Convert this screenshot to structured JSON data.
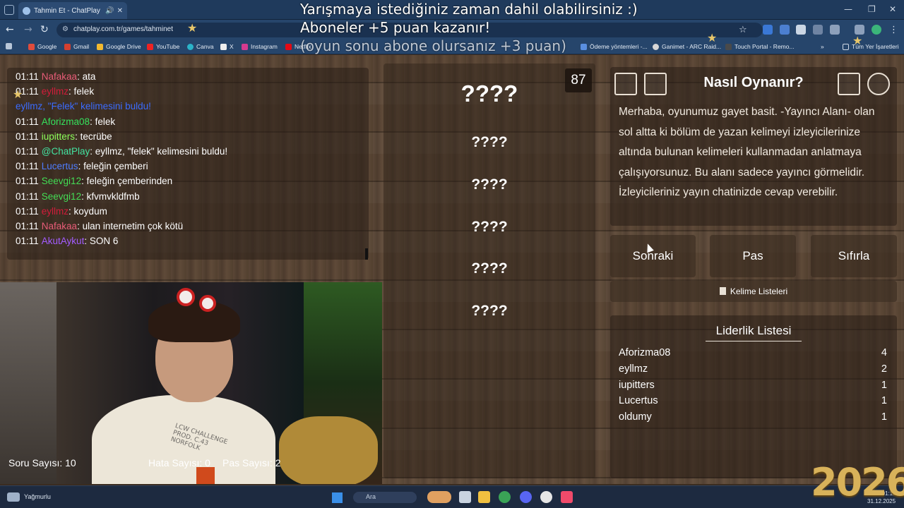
{
  "browser": {
    "tab_title": "Tahmin Et - ChatPlay",
    "url": "chatplay.com.tr/games/tahminet",
    "bookmarks": [
      "Google",
      "Gmail",
      "Google Drive",
      "YouTube",
      "Canva",
      "X",
      "Instagram",
      "Netflix",
      "Ödeme yöntemleri -...",
      "Ganimet - ARC Raid...",
      "Touch Portal - Remo..."
    ],
    "all_bookmarks": "Tüm Yer İşaretleri"
  },
  "overlay": {
    "line1": "Yarışmaya istediğiniz zaman dahil olabilirsiniz :)",
    "line2": "Aboneler +5 puan kazanır!",
    "line3": "(oyun sonu abone olursanız +3 puan)"
  },
  "chat": [
    {
      "time": "01:11",
      "user": "Nafakaa",
      "color": "#e85c78",
      "msg": ": ata"
    },
    {
      "time": "01:11",
      "user": "eyllmz",
      "color": "#d11c3a",
      "msg": ": felek"
    },
    {
      "time": "",
      "user": "",
      "color": "#3b6cff",
      "msg": "eyllmz, \"Felek\" kelimesini buldu!",
      "system": true
    },
    {
      "time": "01:11",
      "user": "Aforizma08",
      "color": "#35e25c",
      "msg": ": felek"
    },
    {
      "time": "01:11",
      "user": "iupitters",
      "color": "#8cff5a",
      "msg": ": tecrübe"
    },
    {
      "time": "01:11",
      "user": "@ChatPlay",
      "color": "#43e2a0",
      "msg": ": eyllmz, \"felek\" kelimesini buldu!"
    },
    {
      "time": "01:11",
      "user": "Lucertus",
      "color": "#4f7dff",
      "msg": ": feleğin çemberi"
    },
    {
      "time": "01:11",
      "user": "Seevgi12",
      "color": "#44dd55",
      "msg": ": feleğin çemberinden"
    },
    {
      "time": "01:11",
      "user": "Seevgi12",
      "color": "#44dd55",
      "msg": ": kfvmvkldfmb"
    },
    {
      "time": "01:11",
      "user": "eyllmz",
      "color": "#d11c3a",
      "msg": ": koydum"
    },
    {
      "time": "01:11",
      "user": "Nafakaa",
      "color": "#e85c78",
      "msg": ": ulan internetim çok kötü"
    },
    {
      "time": "01:11",
      "user": "AkutAykut",
      "color": "#a35cff",
      "msg": ": SON 6"
    }
  ],
  "game": {
    "counter": "87",
    "words": [
      "????",
      "????",
      "????",
      "????",
      "????",
      "????"
    ]
  },
  "howto": {
    "title": "Nasıl Oynanır?",
    "text": "Merhaba, oyunumuz gayet basit. -Yayıncı Alanı- olan sol altta ki bölüm de yazan kelimeyi izleyicilerinize altında bulunan kelimeleri kullanmadan anlatmaya çalışıyorsunuz. Bu alanı sadece yayıncı görmelidir. İzleyicileriniz yayın chatinizde cevap verebilir."
  },
  "buttons": {
    "next": "Sonraki",
    "pass": "Pas",
    "reset": "Sıfırla",
    "wordlists": "Kelime Listeleri"
  },
  "leaderboard": {
    "title": "Liderlik Listesi",
    "rows": [
      {
        "name": "Aforizma08",
        "score": "4"
      },
      {
        "name": "eyllmz",
        "score": "2"
      },
      {
        "name": "iupitters",
        "score": "1"
      },
      {
        "name": "Lucertus",
        "score": "1"
      },
      {
        "name": "oldumy",
        "score": "1"
      }
    ]
  },
  "stats": {
    "questions": "Soru Sayısı: 10",
    "errors": "Hata Sayısı: 0",
    "passes": "Pas Sayısı: 2"
  },
  "taskbar": {
    "weather": "Yağmurlu",
    "search": "Ara",
    "time": "01:11",
    "date": "31.12.2025"
  },
  "year_overlay": "2026"
}
